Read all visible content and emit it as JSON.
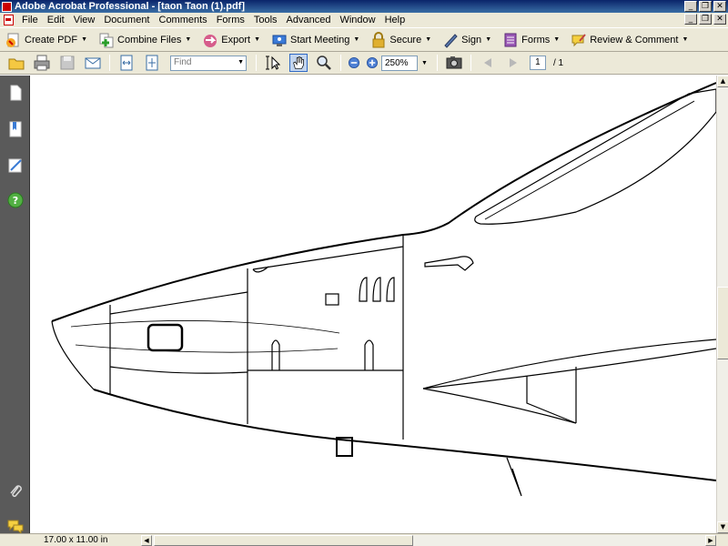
{
  "window": {
    "title": "Adobe Acrobat Professional - [taon Taon (1).pdf]"
  },
  "menu": [
    "File",
    "Edit",
    "View",
    "Document",
    "Comments",
    "Forms",
    "Tools",
    "Advanced",
    "Window",
    "Help"
  ],
  "tasks": {
    "create_pdf": "Create PDF",
    "combine_files": "Combine Files",
    "export": "Export",
    "start_meeting": "Start Meeting",
    "secure": "Secure",
    "sign": "Sign",
    "forms": "Forms",
    "review_comment": "Review & Comment"
  },
  "toolbar": {
    "find_placeholder": "Find",
    "zoom": "250%",
    "page_current": "1",
    "page_total": "/ 1"
  },
  "status": {
    "page_size": "17.00 x 11.00 in"
  },
  "colors": {
    "titlebar": "#0a246a",
    "chrome": "#ece9d8",
    "sidebar": "#5a5a5a"
  }
}
